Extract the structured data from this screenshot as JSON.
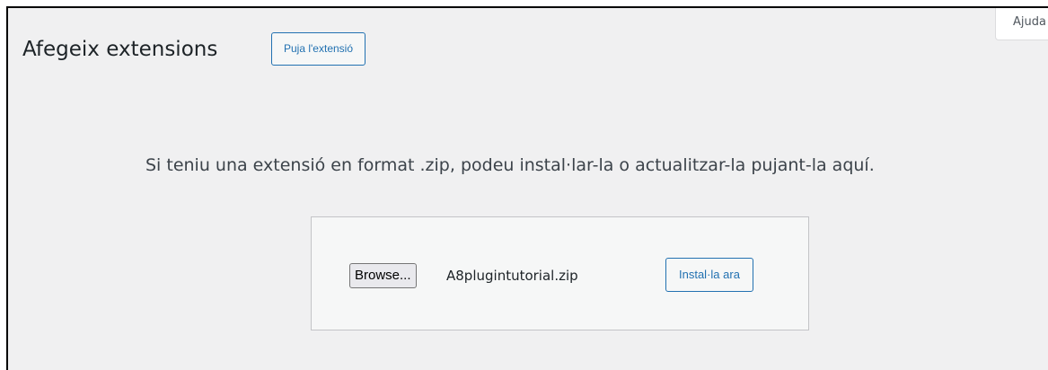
{
  "header": {
    "title": "Afegeix extensions",
    "upload_button_label": "Puja l'extensió",
    "help_tab_label": "Ajuda"
  },
  "upload": {
    "description": "Si teniu una extensió en format .zip, podeu instal·lar-la o actualitzar-la pujant-la aquí.",
    "browse_button_label": "Browse...",
    "selected_file": "A8plugintutorial.zip",
    "install_button_label": "Instal·la ara"
  }
}
